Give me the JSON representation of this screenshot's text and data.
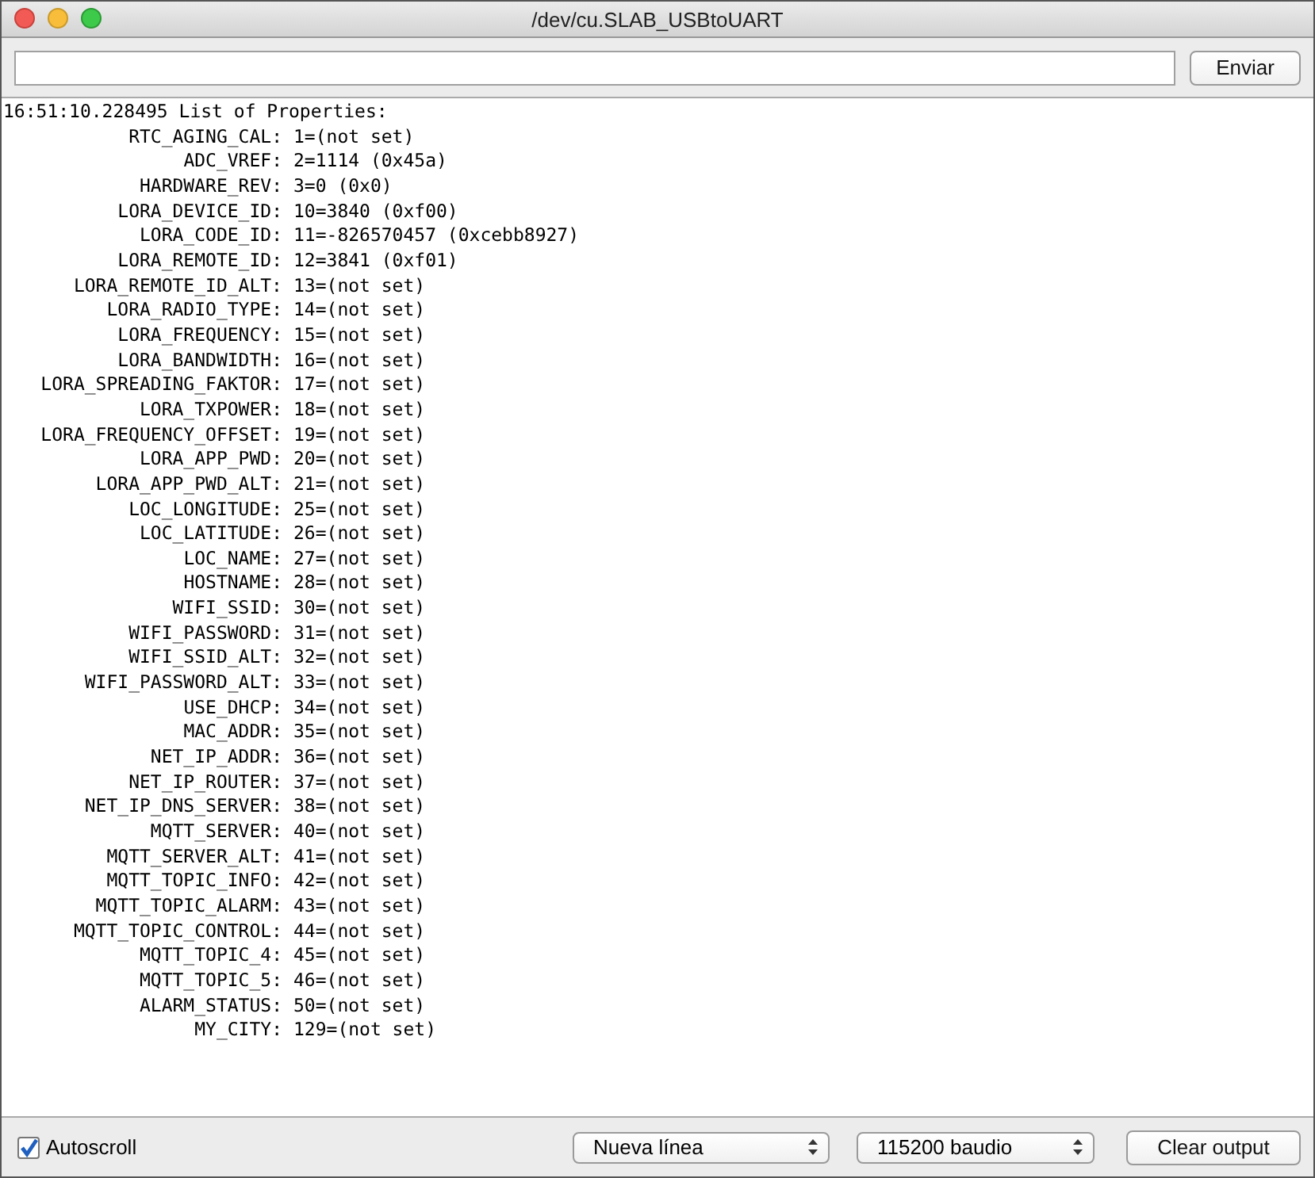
{
  "window": {
    "title": "/dev/cu.SLAB_USBtoUART"
  },
  "send": {
    "button": "Enviar"
  },
  "output": {
    "header": "16:51:10.228495 List of Properties:",
    "lines": [
      {
        "key": "RTC_AGING_CAL:",
        "value": "1=(not set)"
      },
      {
        "key": "ADC_VREF:",
        "value": "2=1114 (0x45a)"
      },
      {
        "key": "HARDWARE_REV:",
        "value": "3=0 (0x0)"
      },
      {
        "key": "LORA_DEVICE_ID:",
        "value": "10=3840 (0xf00)"
      },
      {
        "key": "LORA_CODE_ID:",
        "value": "11=-826570457 (0xcebb8927)"
      },
      {
        "key": "LORA_REMOTE_ID:",
        "value": "12=3841 (0xf01)"
      },
      {
        "key": "LORA_REMOTE_ID_ALT:",
        "value": "13=(not set)"
      },
      {
        "key": "LORA_RADIO_TYPE:",
        "value": "14=(not set)"
      },
      {
        "key": "LORA_FREQUENCY:",
        "value": "15=(not set)"
      },
      {
        "key": "LORA_BANDWIDTH:",
        "value": "16=(not set)"
      },
      {
        "key": "LORA_SPREADING_FAKTOR:",
        "value": "17=(not set)"
      },
      {
        "key": "LORA_TXPOWER:",
        "value": "18=(not set)"
      },
      {
        "key": "LORA_FREQUENCY_OFFSET:",
        "value": "19=(not set)"
      },
      {
        "key": "LORA_APP_PWD:",
        "value": "20=(not set)"
      },
      {
        "key": "LORA_APP_PWD_ALT:",
        "value": "21=(not set)"
      },
      {
        "key": "LOC_LONGITUDE:",
        "value": "25=(not set)"
      },
      {
        "key": "LOC_LATITUDE:",
        "value": "26=(not set)"
      },
      {
        "key": "LOC_NAME:",
        "value": "27=(not set)"
      },
      {
        "key": "HOSTNAME:",
        "value": "28=(not set)"
      },
      {
        "key": "WIFI_SSID:",
        "value": "30=(not set)"
      },
      {
        "key": "WIFI_PASSWORD:",
        "value": "31=(not set)"
      },
      {
        "key": "WIFI_SSID_ALT:",
        "value": "32=(not set)"
      },
      {
        "key": "WIFI_PASSWORD_ALT:",
        "value": "33=(not set)"
      },
      {
        "key": "USE_DHCP:",
        "value": "34=(not set)"
      },
      {
        "key": "MAC_ADDR:",
        "value": "35=(not set)"
      },
      {
        "key": "NET_IP_ADDR:",
        "value": "36=(not set)"
      },
      {
        "key": "NET_IP_ROUTER:",
        "value": "37=(not set)"
      },
      {
        "key": "NET_IP_DNS_SERVER:",
        "value": "38=(not set)"
      },
      {
        "key": "MQTT_SERVER:",
        "value": "40=(not set)"
      },
      {
        "key": "MQTT_SERVER_ALT:",
        "value": "41=(not set)"
      },
      {
        "key": "MQTT_TOPIC_INFO:",
        "value": "42=(not set)"
      },
      {
        "key": "MQTT_TOPIC_ALARM:",
        "value": "43=(not set)"
      },
      {
        "key": "MQTT_TOPIC_CONTROL:",
        "value": "44=(not set)"
      },
      {
        "key": "MQTT_TOPIC_4:",
        "value": "45=(not set)"
      },
      {
        "key": "MQTT_TOPIC_5:",
        "value": "46=(not set)"
      },
      {
        "key": "ALARM_STATUS:",
        "value": "50=(not set)"
      },
      {
        "key": "MY_CITY:",
        "value": "129=(not set)"
      }
    ]
  },
  "status_bar": {
    "autoscroll": {
      "label": "Autoscroll",
      "checked": true
    },
    "line_ending": "Nueva línea",
    "baud_rate": "115200 baudio",
    "clear_button": "Clear output"
  }
}
